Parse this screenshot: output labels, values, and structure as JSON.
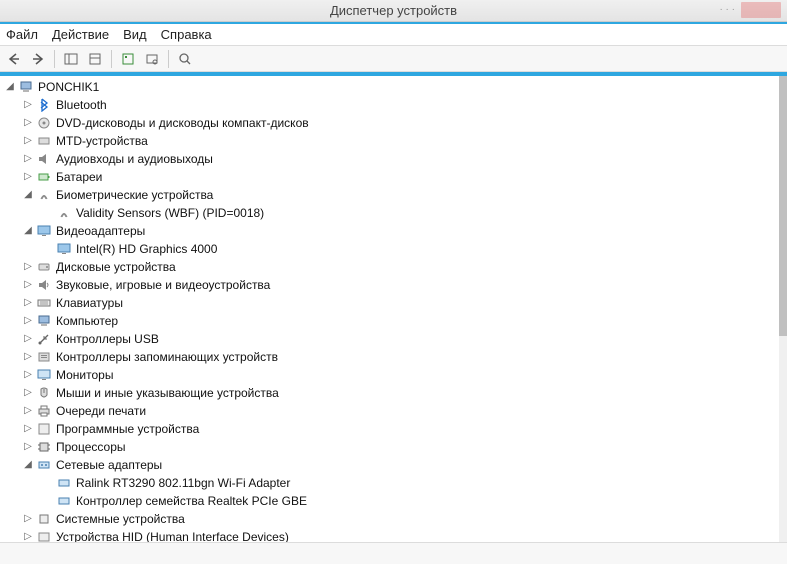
{
  "window": {
    "title": "Диспетчер устройств"
  },
  "menu": {
    "file": "Файл",
    "action": "Действие",
    "view": "Вид",
    "help": "Справка"
  },
  "tree": {
    "root": {
      "label": "PONCHIK1"
    },
    "bluetooth": {
      "label": "Bluetooth"
    },
    "dvd": {
      "label": "DVD-дисководы и дисководы компакт-дисков"
    },
    "mtd": {
      "label": "MTD-устройства"
    },
    "audio": {
      "label": "Аудиовходы и аудиовыходы"
    },
    "battery": {
      "label": "Батареи"
    },
    "biometric": {
      "label": "Биометрические устройства"
    },
    "biometric_child": {
      "label": "Validity Sensors (WBF) (PID=0018)"
    },
    "video": {
      "label": "Видеоадаптеры"
    },
    "video_child": {
      "label": "Intel(R) HD Graphics 4000"
    },
    "disk": {
      "label": "Дисковые устройства"
    },
    "sound": {
      "label": "Звуковые, игровые и видеоустройства"
    },
    "keyboards": {
      "label": "Клавиатуры"
    },
    "computer": {
      "label": "Компьютер"
    },
    "usb": {
      "label": "Контроллеры USB"
    },
    "storage": {
      "label": "Контроллеры запоминающих устройств"
    },
    "monitors": {
      "label": "Мониторы"
    },
    "mice": {
      "label": "Мыши и иные указывающие устройства"
    },
    "printq": {
      "label": "Очереди печати"
    },
    "software": {
      "label": "Программные устройства"
    },
    "cpu": {
      "label": "Процессоры"
    },
    "network": {
      "label": "Сетевые адаптеры"
    },
    "network_child1": {
      "label": "Ralink RT3290 802.11bgn Wi-Fi Adapter"
    },
    "network_child2": {
      "label": "Контроллер семейства Realtek PCIe GBE"
    },
    "system": {
      "label": "Системные устройства"
    },
    "hid": {
      "label": "Устройства HID (Human Interface Devices)"
    }
  }
}
